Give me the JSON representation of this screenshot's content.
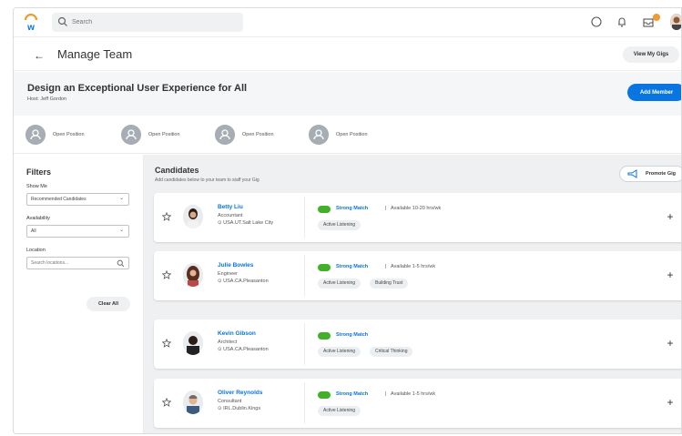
{
  "topbar": {
    "search_placeholder": "Search"
  },
  "header": {
    "title": "Manage Team",
    "view_gigs_label": "View My Gigs"
  },
  "gig": {
    "title": "Design an Exceptional User Experience for All",
    "host": "Host: Jeff Gordon",
    "add_member_label": "Add Member"
  },
  "positions": [
    {
      "label": "Open Position"
    },
    {
      "label": "Open Position"
    },
    {
      "label": "Open Position"
    },
    {
      "label": "Open Position"
    }
  ],
  "filters": {
    "title": "Filters",
    "show_me_label": "Show Me",
    "show_me_value": "Recommended Candidates",
    "availability_label": "Availability",
    "availability_value": "All",
    "location_label": "Location",
    "location_placeholder": "Search locations...",
    "clear_all_label": "Clear All"
  },
  "candidates": {
    "title": "Candidates",
    "subtitle": "Add candidates below to your team to staff your Gig",
    "promote_label": "Promote Gig",
    "items": [
      {
        "name": "Betty Liu",
        "role": "Accountant",
        "location": "USA.UT.Salt Lake City",
        "match": "Strong Match",
        "availability": "Available 10-20 hrs/wk",
        "skills": [
          "Active Listening"
        ]
      },
      {
        "name": "Julie Bowles",
        "role": "Engineer",
        "location": "USA.CA.Pleasanton",
        "match": "Strong Match",
        "availability": "Available 1-5 hrs/wk",
        "skills": [
          "Active Listening",
          "Building Trust"
        ]
      },
      {
        "name": "Kevin Gibson",
        "role": "Architect",
        "location": "USA.CA.Pleasanton",
        "match": "Strong Match",
        "availability": "",
        "skills": [
          "Active Listening",
          "Critical Thinking"
        ]
      },
      {
        "name": "Oliver Reynolds",
        "role": "Consultant",
        "location": "IRL.Dublin.Kings",
        "match": "Strong Match",
        "availability": "Available 1-5 hrs/wk",
        "skills": [
          "Active Listening"
        ]
      }
    ]
  },
  "colors": {
    "accent_blue": "#0875e1",
    "match_green": "#43b02a",
    "notification_orange": "#f29a2e"
  },
  "icons": [
    "workday-logo-icon",
    "search-icon",
    "chat-icon",
    "bell-icon",
    "inbox-icon",
    "user-avatar",
    "back-arrow-icon",
    "open-position-icon",
    "chevron-down-icon",
    "megaphone-icon",
    "star-icon",
    "location-pin-icon",
    "match-icon",
    "plus-icon"
  ]
}
